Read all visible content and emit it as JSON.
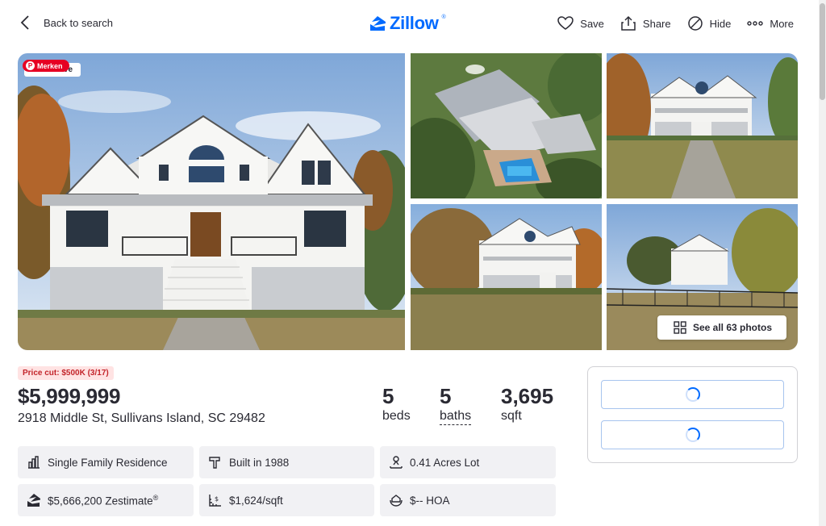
{
  "header": {
    "back_label": "Back to search",
    "logo_text": "Zillow",
    "logo_reg": "®",
    "actions": {
      "save": "Save",
      "share": "Share",
      "hide": "Hide",
      "more": "More"
    }
  },
  "gallery": {
    "status_tag": "Active",
    "pin_badge": "Merken",
    "see_all": "See all 63 photos"
  },
  "listing": {
    "price_cut": "Price cut: $500K (3/17)",
    "price": "$5,999,999",
    "address": "2918 Middle St, Sullivans Island, SC 29482",
    "beds_value": "5",
    "beds_label": "beds",
    "baths_value": "5",
    "baths_label": "baths",
    "sqft_value": "3,695",
    "sqft_label": "sqft"
  },
  "facts": {
    "type": "Single Family Residence",
    "built": "Built in 1988",
    "lot": "0.41 Acres Lot",
    "zestimate": "$5,666,200 Zestimate",
    "zestimate_reg": "®",
    "price_sqft": "$1,624/sqft",
    "hoa": "$-- HOA"
  },
  "colors": {
    "brand": "#006aff",
    "price_cut_bg": "#ffe3e3",
    "price_cut_text": "#c3252b",
    "fact_bg": "#f1f1f4"
  }
}
